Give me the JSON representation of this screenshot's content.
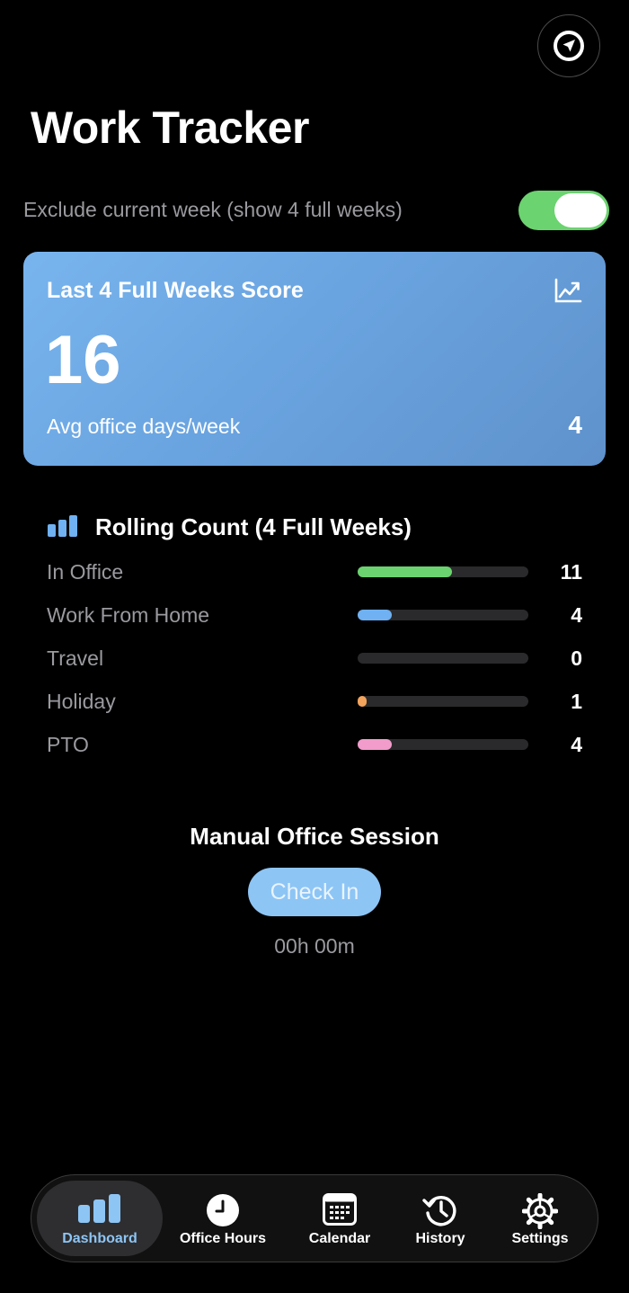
{
  "app": {
    "title": "Work Tracker"
  },
  "toggle": {
    "label": "Exclude current week (show 4 full weeks)",
    "on": true
  },
  "score_card": {
    "title": "Last 4 Full Weeks Score",
    "score": "16",
    "avg_label": "Avg office days/week",
    "avg_value": "4"
  },
  "rolling": {
    "title": "Rolling Count (4 Full Weeks)",
    "rows": [
      {
        "label": "In Office",
        "value": "11",
        "fraction": 0.55,
        "color": "#6bd36f"
      },
      {
        "label": "Work From Home",
        "value": "4",
        "fraction": 0.2,
        "color": "#6fb1f2"
      },
      {
        "label": "Travel",
        "value": "0",
        "fraction": 0,
        "color": "#6fb1f2"
      },
      {
        "label": "Holiday",
        "value": "1",
        "fraction": 0.05,
        "color": "#f4a45c"
      },
      {
        "label": "PTO",
        "value": "4",
        "fraction": 0.2,
        "color": "#f29ccb"
      }
    ]
  },
  "manual_session": {
    "title": "Manual Office Session",
    "button_label": "Check In",
    "timer": "00h 00m"
  },
  "tabs": [
    {
      "label": "Dashboard",
      "icon": "bar-chart-icon",
      "active": true
    },
    {
      "label": "Office Hours",
      "icon": "clock-icon",
      "active": false
    },
    {
      "label": "Calendar",
      "icon": "calendar-icon",
      "active": false
    },
    {
      "label": "History",
      "icon": "history-icon",
      "active": false
    },
    {
      "label": "Settings",
      "icon": "gear-icon",
      "active": false
    }
  ],
  "colors": {
    "accent": "#8dc5f5",
    "toggle_on": "#6bd36f",
    "card_start": "#78b4ee",
    "card_end": "#5f92cc"
  }
}
